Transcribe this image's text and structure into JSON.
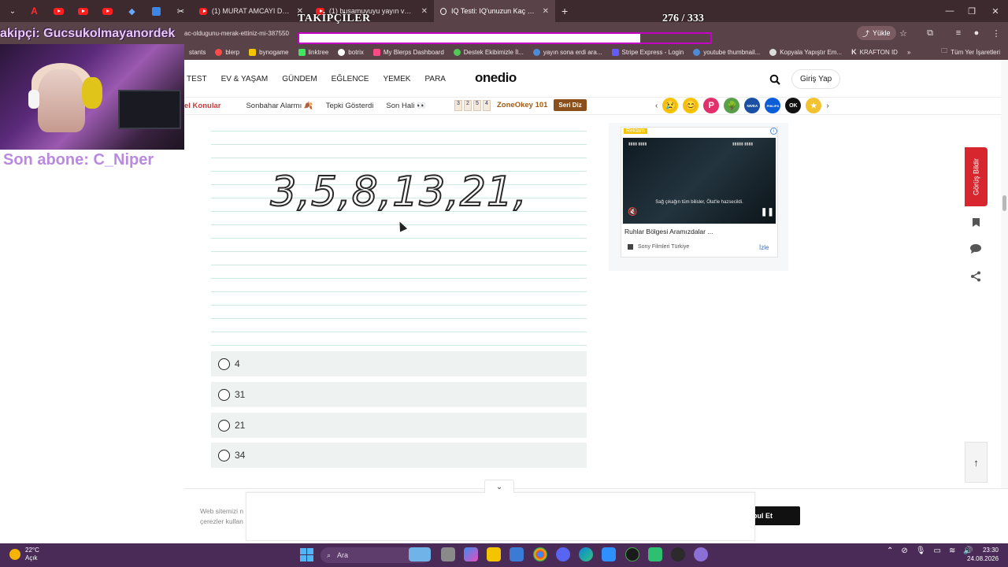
{
  "browser": {
    "tabs": [
      {
        "title": "(1) MURAT AMCAYI DİRİ DİRİ M",
        "active": false
      },
      {
        "title": "(1) busamuyuyu yayın vakti 7 - Y",
        "active": false
      },
      {
        "title": "IQ Testi: IQ'unuzun Kaç Olduğu",
        "active": true
      }
    ],
    "url": "ac-oldugunu-merak-ettiniz-mi-387550",
    "upload_label": "Yükle",
    "bookmarks": [
      {
        "label": "stants",
        "color": "#7a5b62"
      },
      {
        "label": "blerp",
        "color": "#ff4a4a"
      },
      {
        "label": "bynogame",
        "color": "#f5c400"
      },
      {
        "label": "linktree",
        "color": "#43e660"
      },
      {
        "label": "botrix",
        "color": "#ffffff"
      },
      {
        "label": "My Blerps Dashboard",
        "color": "#ff4a8a"
      },
      {
        "label": "Destek Ekibimizle İl...",
        "color": "#53c653"
      },
      {
        "label": "yayın sona erdi ara...",
        "color": "#4d8bd6"
      },
      {
        "label": "Stripe Express - Login",
        "color": "#635bff"
      },
      {
        "label": "youtube thumbnail...",
        "color": "#4d8bd6"
      },
      {
        "label": "Kopyala Yapıştır Em...",
        "color": "#dddddd"
      },
      {
        "label": "KRAFTON ID",
        "color": "#222222"
      }
    ],
    "bookmarks_more": "»",
    "all_bookmarks": "Tüm Yer İşaretleri"
  },
  "stream": {
    "follow_title": "TAKİPÇİLER",
    "follow_count": "276 / 333",
    "follow_progress": 0.8288,
    "last_follower": "akipçi: Gucsukolmayanordek",
    "last_sub": "Son abone: C_Niper"
  },
  "site": {
    "nav": [
      "TEST",
      "EV & YAŞAM",
      "GÜNDEM",
      "EĞLENCE",
      "YEMEK",
      "PARA"
    ],
    "logo": "onedio",
    "login": "Giriş Yap",
    "subnav": [
      {
        "label": "el Konular",
        "hot": true
      },
      {
        "label": "Sonbahar Alarmı 🍂",
        "hot": false
      },
      {
        "label": "Tepki Gösterdi",
        "hot": false
      },
      {
        "label": "Son Hali 👀",
        "hot": false
      }
    ],
    "zoneokey": {
      "tiles": [
        "3",
        "2",
        "5",
        "4"
      ],
      "name": "ZoneOkey 101",
      "button": "Seri Diz"
    },
    "reactions": [
      {
        "label": "😢",
        "color": "#f5c400"
      },
      {
        "label": "😊",
        "color": "#f5c400"
      },
      {
        "label": "P",
        "color": "#e1306c"
      },
      {
        "label": "🌳",
        "color": "#5aa04a"
      },
      {
        "label": "NIVEA",
        "color": "#1a4fa3"
      },
      {
        "label": "PHILIPS",
        "color": "#0b5ed7"
      },
      {
        "label": "OK",
        "color": "#111111"
      },
      {
        "label": "★",
        "color": "#f2c230"
      }
    ]
  },
  "question": {
    "sequence": "3,5,8,13,21,",
    "options": [
      "4",
      "31",
      "21",
      "34"
    ]
  },
  "ad": {
    "tag": "Reklam",
    "info": "i",
    "caption": "Sağ çıkağın tüm bilisler, Ölat'le hazsecildi.",
    "headline": "Ruhlar Bölgesi Aramızdalar ...",
    "source": "Sony Filmleri Türkiye",
    "cta": "İzle"
  },
  "rail": {
    "feedback": "Görüş Bildir"
  },
  "cookie": {
    "text_line1": "Web sitemizi n",
    "text_line2": "çerezler kullan",
    "accept": "bul Et"
  },
  "taskbar": {
    "temp": "22°C",
    "condition": "Açık",
    "search": "Ara",
    "time": "23:30",
    "date": "24.08.2026"
  }
}
